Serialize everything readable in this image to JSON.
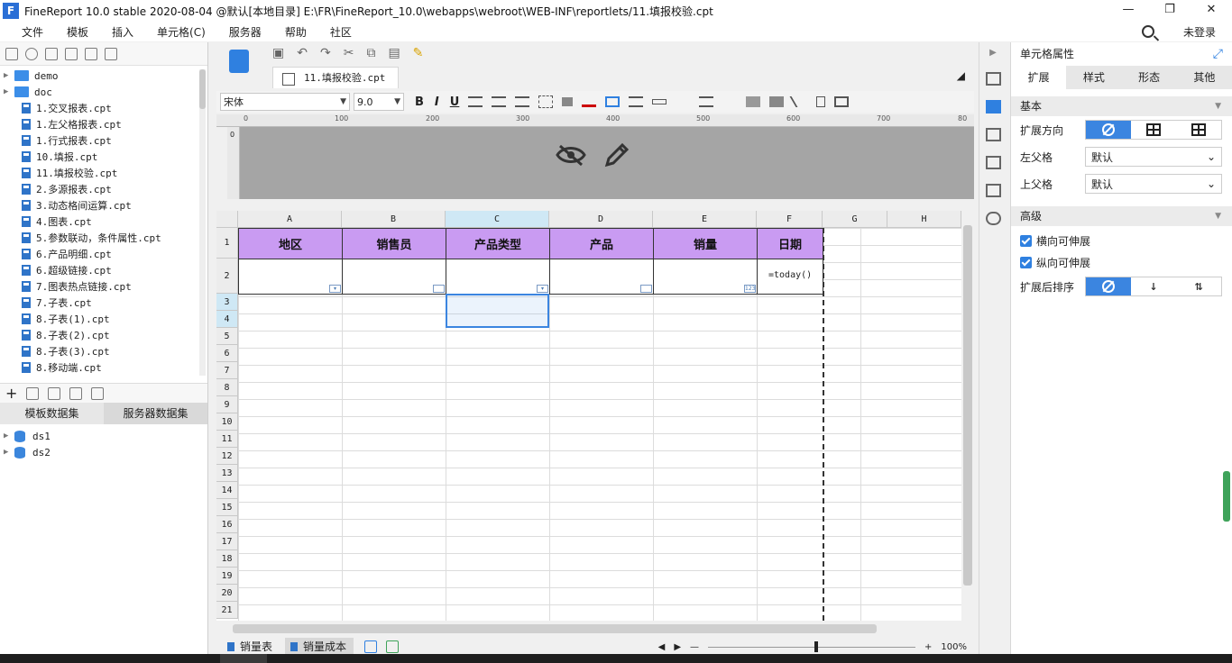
{
  "window": {
    "title": "FineReport 10.0 stable 2020-08-04 @默认[本地目录]     E:\\FR\\FineReport_10.0\\webapps\\webroot\\WEB-INF\\reportlets/11.填报校验.cpt",
    "logo_letter": "F",
    "minimize": "—",
    "maximize": "❐",
    "close": "✕"
  },
  "menu": {
    "items": [
      "文件",
      "模板",
      "插入",
      "单元格(C)",
      "服务器",
      "帮助",
      "社区"
    ],
    "login": "未登录"
  },
  "tree": {
    "folders": [
      "demo",
      "doc"
    ],
    "files": [
      "1.交叉报表.cpt",
      "1.左父格报表.cpt",
      "1.行式报表.cpt",
      "10.填报.cpt",
      "11.填报校验.cpt",
      "2.多源报表.cpt",
      "3.动态格间运算.cpt",
      "4.图表.cpt",
      "5.参数联动，条件属性.cpt",
      "6.产品明细.cpt",
      "6.超级链接.cpt",
      "7.图表热点链接.cpt",
      "7.子表.cpt",
      "8.子表(1).cpt",
      "8.子表(2).cpt",
      "8.子表(3).cpt",
      "8.移动端.cpt"
    ]
  },
  "datasets": {
    "tab_template": "模板数据集",
    "tab_server": "服务器数据集",
    "items": [
      "ds1",
      "ds2"
    ]
  },
  "editor": {
    "file_tab": "11.填报校验.cpt",
    "font_name": "宋体",
    "font_size": "9.0",
    "bold": "B",
    "italic": "I",
    "underline": "U",
    "ruler_marks": [
      "0",
      "100",
      "200",
      "300",
      "400",
      "500",
      "600",
      "700",
      "80"
    ],
    "vruler_mark": "0"
  },
  "grid": {
    "columns": [
      "A",
      "B",
      "C",
      "D",
      "E",
      "F",
      "G",
      "H"
    ],
    "rows": [
      "1",
      "2",
      "3",
      "4",
      "5",
      "6",
      "7",
      "8",
      "9",
      "10",
      "11",
      "12",
      "13",
      "14",
      "15",
      "16",
      "17",
      "18",
      "19",
      "20",
      "21"
    ],
    "headers": [
      "地区",
      "销售员",
      "产品类型",
      "产品",
      "销量",
      "日期"
    ],
    "formula": "=today()",
    "number_widget_label": "123"
  },
  "sheets": {
    "tabs": [
      "销量表",
      "销量成本"
    ],
    "zoom": "100%",
    "minus": "—",
    "plus": "+"
  },
  "props": {
    "title": "单元格属性",
    "tabs": [
      "扩展",
      "样式",
      "形态",
      "其他"
    ],
    "section_basic": "基本",
    "expand_direction_label": "扩展方向",
    "left_parent_label": "左父格",
    "left_parent_value": "默认",
    "up_parent_label": "上父格",
    "up_parent_value": "默认",
    "section_advanced": "高级",
    "horizontal_expand": "横向可伸展",
    "vertical_expand": "纵向可伸展",
    "sort_label": "扩展后排序"
  },
  "colors": {
    "header_cell": "#c99bf2",
    "accent": "#2f80e0",
    "selection": "#3b85e0"
  }
}
